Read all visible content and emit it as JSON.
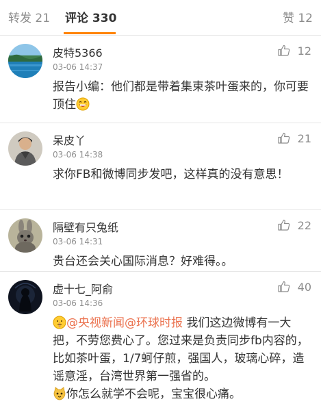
{
  "tabs": {
    "repost": "转发 21",
    "comments": "评论 330",
    "likes": "赞 12"
  },
  "colors": {
    "accent": "#ff8200",
    "mention": "#eb7350"
  },
  "comments": [
    {
      "username": "皮特5366",
      "timestamp": "03-06 14:37",
      "likes": "12",
      "avatar": "lake-avatar",
      "text": "报告小编：他们都是带着集束茶叶蛋来的，你可要顶住",
      "emoji": "grin-face-emoji"
    },
    {
      "username": "呆皮丫",
      "timestamp": "03-06 14:38",
      "likes": "21",
      "avatar": "person-avatar",
      "text": "求你FB和微博同步发吧，这样真的没有意思！"
    },
    {
      "username": "隔壁有只兔纸",
      "timestamp": "03-06 14:31",
      "likes": "22",
      "avatar": "rabbit-avatar",
      "text": "贵台还会关心国际消息？好难得。。"
    },
    {
      "username": "虚十七_阿俞",
      "timestamp": "03-06 14:36",
      "likes": "40",
      "avatar": "dark-silhouette-avatar",
      "lead_emoji": "shush-face-emoji",
      "mention1": "@央视新闻",
      "mention2": "@环球时报",
      "text": " 我们这边微博有一大把，不劳您费心了。您过来是负责同步fb内容的，比如茶叶蛋，1/7蚵仔煎，强国人，玻璃心碎，造谣意淫，台湾世界第一强省的。",
      "emoji2": "cat-face-emoji",
      "text2": "你怎么就学不会呢，宝宝很心痛。"
    }
  ]
}
